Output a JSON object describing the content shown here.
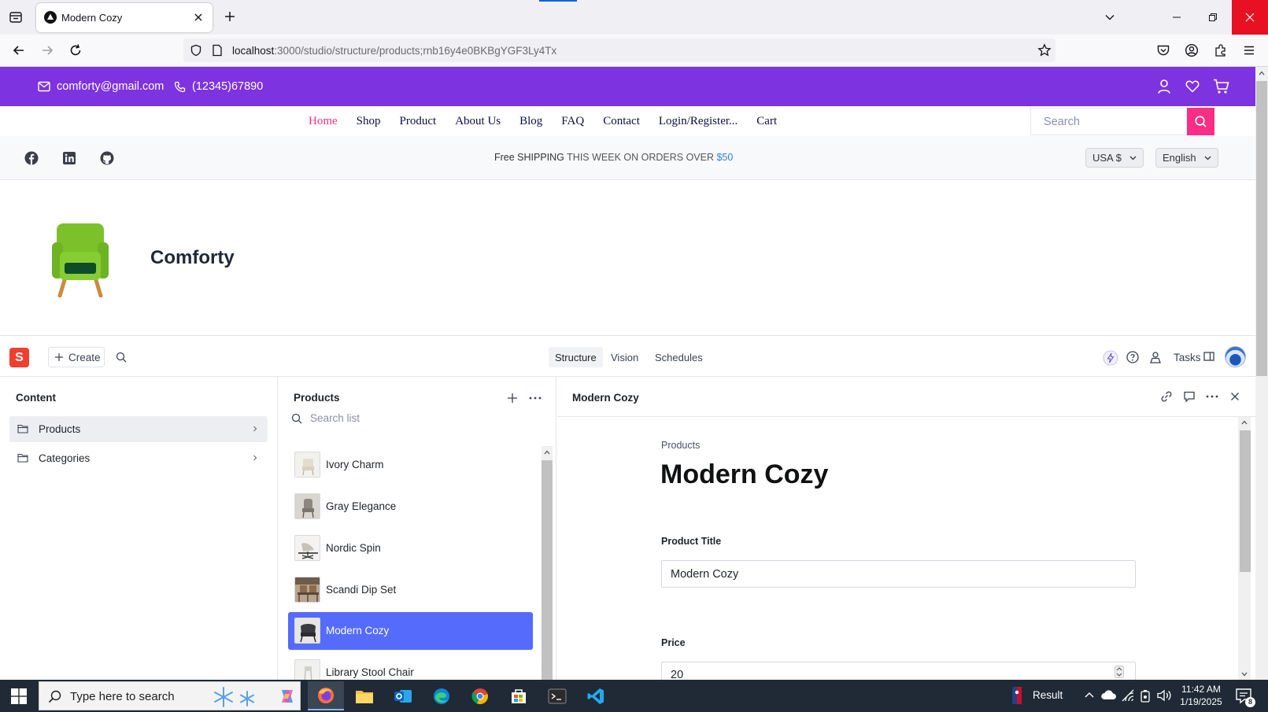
{
  "browser": {
    "tab_title": "Modern Cozy",
    "url_host": "localhost",
    "url_path": ":3000/studio/structure/products;rnb16y4e0BKBgYGF3Ly4Tx"
  },
  "site": {
    "email": "comforty@gmail.com",
    "phone": "(12345)67890",
    "menu": [
      "Home",
      "Shop",
      "Product",
      "About Us",
      "Blog",
      "FAQ",
      "Contact",
      "Login/Register...",
      "Cart"
    ],
    "search_placeholder": "Search",
    "shipping_bold": "Free SHIPPING",
    "shipping_light": " THIS WEEK ON ORDERS OVER ",
    "shipping_amount": "$50",
    "currency": "USA $",
    "language": "English",
    "brand_name": "Comforty",
    "colors": {
      "topbar": "#7e33e0",
      "accent": "#fb2e86"
    }
  },
  "studio": {
    "create_label": "Create",
    "tools": [
      "Structure",
      "Vision",
      "Schedules"
    ],
    "tasks_label": "Tasks",
    "content_pane": {
      "title": "Content",
      "items": [
        {
          "label": "Products",
          "icon": "folder-icon"
        },
        {
          "label": "Categories",
          "icon": "folder-icon"
        }
      ]
    },
    "products_pane": {
      "title": "Products",
      "search_placeholder": "Search list",
      "items": [
        "Ivory Charm",
        "Gray Elegance",
        "Nordic Spin",
        "Scandi Dip Set",
        "Modern Cozy",
        "Library Stool Chair"
      ],
      "selected": "Modern Cozy"
    },
    "document": {
      "header_title": "Modern Cozy",
      "breadcrumb": "Products",
      "title": "Modern Cozy",
      "fields": [
        {
          "label": "Product Title",
          "value": "Modern Cozy"
        },
        {
          "label": "Price",
          "value": "20"
        }
      ]
    }
  },
  "taskbar": {
    "search_placeholder": "Type here to search",
    "tray_label": "Result",
    "time": "11:42 AM",
    "date": "1/19/2025",
    "notifications": "8"
  }
}
